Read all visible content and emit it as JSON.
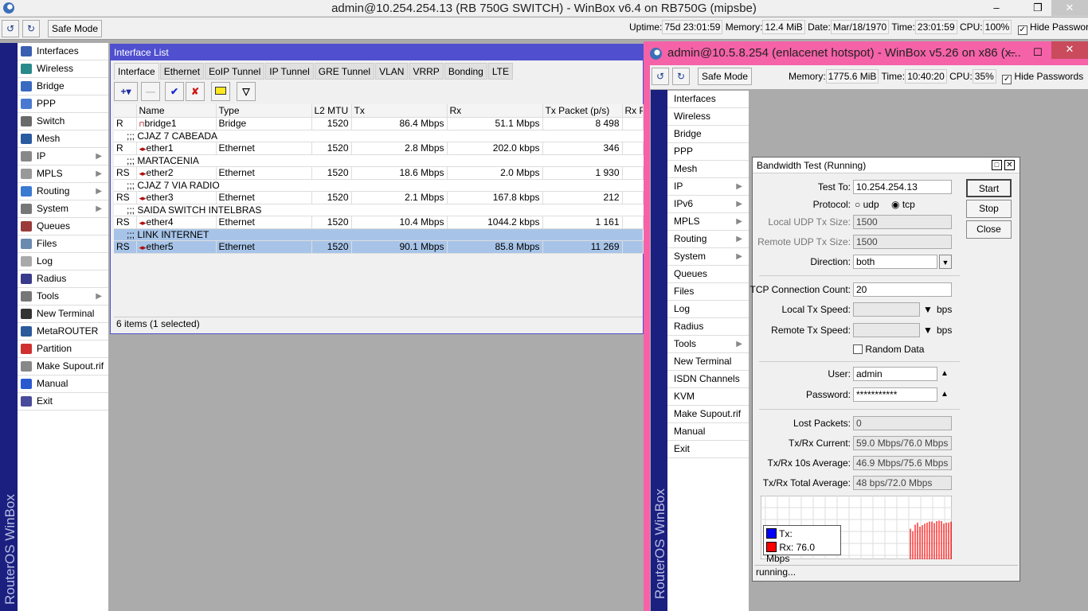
{
  "main_window": {
    "title": "admin@10.254.254.13 (RB 750G SWITCH) - WinBox v6.4 on RB750G (mipsbe)",
    "safe_mode": "Safe Mode",
    "status": {
      "uptime_label": "Uptime:",
      "uptime": "75d 23:01:59",
      "memory_label": "Memory:",
      "memory": "12.4 MiB",
      "date_label": "Date:",
      "date": "Mar/18/1970",
      "time_label": "Time:",
      "time": "23:01:59",
      "cpu_label": "CPU:",
      "cpu": "100%",
      "hide_passwords": "Hide Passwords"
    },
    "brand": "RouterOS WinBox",
    "menu": [
      "Interfaces",
      "Wireless",
      "Bridge",
      "PPP",
      "Switch",
      "Mesh",
      "IP",
      "MPLS",
      "Routing",
      "System",
      "Queues",
      "Files",
      "Log",
      "Radius",
      "Tools",
      "New Terminal",
      "MetaROUTER",
      "Partition",
      "Make Supout.rif",
      "Manual",
      "Exit"
    ]
  },
  "interface_list": {
    "title": "Interface List",
    "tabs": [
      "Interface",
      "Ethernet",
      "EoIP Tunnel",
      "IP Tunnel",
      "GRE Tunnel",
      "VLAN",
      "VRRP",
      "Bonding",
      "LTE"
    ],
    "columns": [
      "",
      "Name",
      "Type",
      "L2 MTU",
      "Tx",
      "Rx",
      "Tx Packet (p/s)",
      "Rx Pa"
    ],
    "rows": [
      {
        "flags": "R",
        "name": "bridge1",
        "type": "Bridge",
        "mtu": "1520",
        "tx": "86.4 Mbps",
        "rx": "51.1 Mbps",
        "txp": "8 498"
      },
      {
        "comment": ";;; CJAZ 7 CABEADA"
      },
      {
        "flags": "R",
        "name": "ether1",
        "type": "Ethernet",
        "mtu": "1520",
        "tx": "2.8 Mbps",
        "rx": "202.0 kbps",
        "txp": "346"
      },
      {
        "comment": ";;; MARTACENIA"
      },
      {
        "flags": "RS",
        "name": "ether2",
        "type": "Ethernet",
        "mtu": "1520",
        "tx": "18.6 Mbps",
        "rx": "2.0 Mbps",
        "txp": "1 930"
      },
      {
        "comment": ";;; CJAZ 7 VIA RADIO"
      },
      {
        "flags": "RS",
        "name": "ether3",
        "type": "Ethernet",
        "mtu": "1520",
        "tx": "2.1 Mbps",
        "rx": "167.8 kbps",
        "txp": "212"
      },
      {
        "comment": ";;; SAIDA SWITCH INTELBRAS"
      },
      {
        "flags": "RS",
        "name": "ether4",
        "type": "Ethernet",
        "mtu": "1520",
        "tx": "10.4 Mbps",
        "rx": "1044.2 kbps",
        "txp": "1 161"
      },
      {
        "comment": ";;; LINK INTERNET",
        "selected": true
      },
      {
        "flags": "RS",
        "name": "ether5",
        "type": "Ethernet",
        "mtu": "1520",
        "tx": "90.1 Mbps",
        "rx": "85.8 Mbps",
        "txp": "11 269",
        "selected": true
      }
    ],
    "status": "6 items (1 selected)"
  },
  "second_window": {
    "title": "admin@10.5.8.254 (enlacenet hotspot) - WinBox v5.26 on x86 (x...",
    "safe_mode": "Safe Mode",
    "status": {
      "memory_label": "Memory:",
      "memory": "1775.6 MiB",
      "time_label": "Time:",
      "time": "10:40:20",
      "cpu_label": "CPU:",
      "cpu": "35%",
      "hide_passwords": "Hide Passwords"
    },
    "brand": "RouterOS WinBox",
    "menu": [
      "Interfaces",
      "Wireless",
      "Bridge",
      "PPP",
      "Mesh",
      "IP",
      "IPv6",
      "MPLS",
      "Routing",
      "System",
      "Queues",
      "Files",
      "Log",
      "Radius",
      "Tools",
      "New Terminal",
      "ISDN Channels",
      "KVM",
      "Make Supout.rif",
      "Manual",
      "Exit"
    ]
  },
  "bandwidth_test": {
    "title": "Bandwidth Test (Running)",
    "test_to_label": "Test To:",
    "test_to": "10.254.254.13",
    "protocol_label": "Protocol:",
    "udp": "udp",
    "tcp": "tcp",
    "protocol": "tcp",
    "local_udp_label": "Local UDP Tx Size:",
    "local_udp": "1500",
    "remote_udp_label": "Remote UDP Tx Size:",
    "remote_udp": "1500",
    "direction_label": "Direction:",
    "direction": "both",
    "tcp_count_label": "TCP Connection Count:",
    "tcp_count": "20",
    "local_speed_label": "Local Tx Speed:",
    "remote_speed_label": "Remote Tx Speed:",
    "bps": "bps",
    "random_data": "Random Data",
    "user_label": "User:",
    "user": "admin",
    "password_label": "Password:",
    "password": "***********",
    "lost_label": "Lost Packets:",
    "lost": "0",
    "current_label": "Tx/Rx Current:",
    "current": "59.0 Mbps/76.0 Mbps",
    "avg10_label": "Tx/Rx 10s Average:",
    "avg10": "46.9 Mbps/75.6 Mbps",
    "total_label": "Tx/Rx Total Average:",
    "total": "48 bps/72.0 Mbps",
    "start": "Start",
    "stop": "Stop",
    "close": "Close",
    "legend_tx": "Tx:",
    "legend_rx": "Rx:  76.0 Mbps",
    "rx_bars": [
      60,
      55,
      68,
      72,
      64,
      67,
      70,
      72,
      74,
      74,
      71,
      75,
      76,
      75,
      70,
      72,
      72,
      74
    ],
    "colors": {
      "tx": "#0000ff",
      "rx": "#ff0000"
    },
    "status": "running..."
  }
}
